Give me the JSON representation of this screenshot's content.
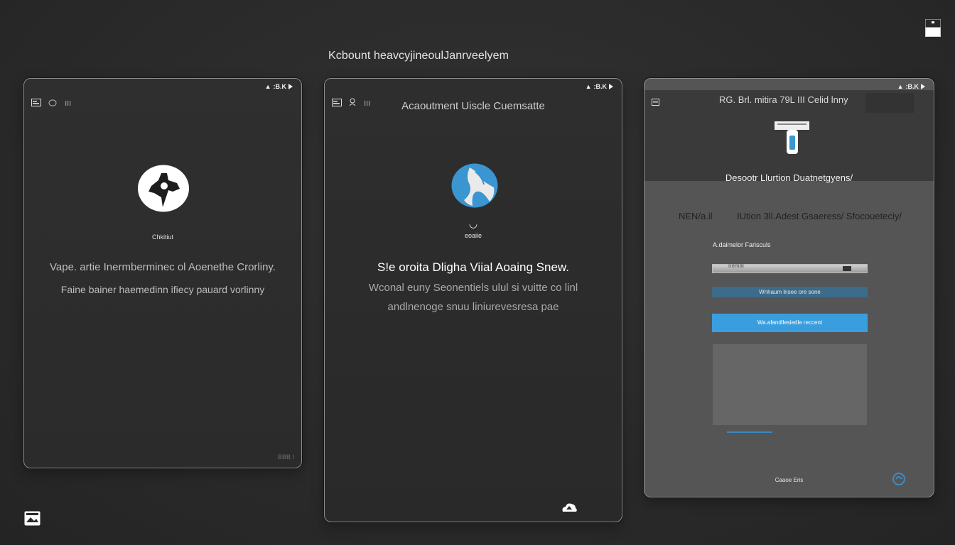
{
  "caption": "Kcbount heavcyjineoulJanrveelyem",
  "status_bar": {
    "text": ":B.K"
  },
  "screens": [
    {
      "label": "Chkitiut",
      "lines": [
        "Vape. artie Inermberminec ol Aoenethe Crorliny.",
        "Faine bainer haemedinn ifiecy pauard vorlinny"
      ],
      "footer": "BBB I"
    },
    {
      "title": "Acaoutment Uiscle Cuemsatte",
      "small_label": "eoaiie",
      "heading": "S!e oroita  Dligha Viial Aoaing Snew.",
      "lines": [
        "Wconal euny Seonentiels ulul si vuitte  co linl",
        "andlnenoge snuu  liniurevesresa pae"
      ]
    },
    {
      "header_text": "RG. Brl. mitira  79L III Celid lnny",
      "title": "Desootr Llurtion Duatnetgyens/",
      "row_left": "NEN/a.il",
      "row_right": "IUtion 3ll.Adest Gsaeress/ Sfocoueteciy/",
      "field_label": "A.daimelor Farisculs",
      "input_placeholder": "nemal",
      "button1": "Wnhaum lnsee ore sone",
      "button2": "Wa.afandllesiedle reccent",
      "footer": "Caaoe Eris"
    }
  ]
}
